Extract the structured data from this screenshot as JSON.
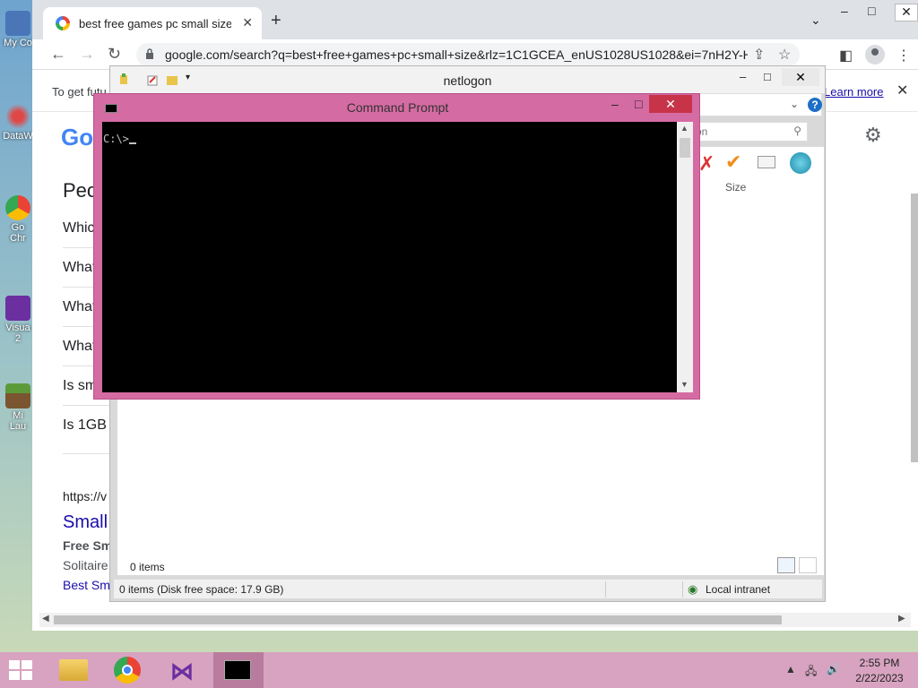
{
  "desktop": {
    "icons": [
      {
        "label": "My Co",
        "name": "my-computer"
      },
      {
        "label": "DataW",
        "name": "datawarehouse"
      },
      {
        "label": "Go\nChr",
        "name": "google-chrome"
      },
      {
        "label": "Visua\n2",
        "name": "visual-studio"
      },
      {
        "label": "Mi\nLau",
        "name": "minecraft-launcher"
      }
    ]
  },
  "chrome": {
    "tab_title": "best free games pc small size - G",
    "url": "google.com/search?q=best+free+games+pc+small+size&rlz=1C1GCEA_enUS1028US1028&ei=7nH2Y-HI...",
    "banner_text": "To get futu",
    "learn_more": "Learn more",
    "logo_text": "Go",
    "people_also_ask": "Peo",
    "questions": [
      "Whic",
      "What",
      "What",
      "What",
      "Is sm",
      "Is 1GB"
    ],
    "result": {
      "url": "https://v",
      "title": "Small",
      "line1": "Free Sm",
      "line2": "Solitaire",
      "line3": "Best Sm"
    }
  },
  "explorer": {
    "title": "netlogon",
    "search_placeholder": "on",
    "column_size": "Size",
    "items_count": "0 items",
    "status_left": "0 items (Disk free space: 17.9 GB)",
    "status_right": "Local intranet"
  },
  "cmd": {
    "title": "Command Prompt",
    "prompt": "C:\\>"
  },
  "taskbar": {
    "time": "2:55 PM",
    "date": "2/22/2023"
  }
}
